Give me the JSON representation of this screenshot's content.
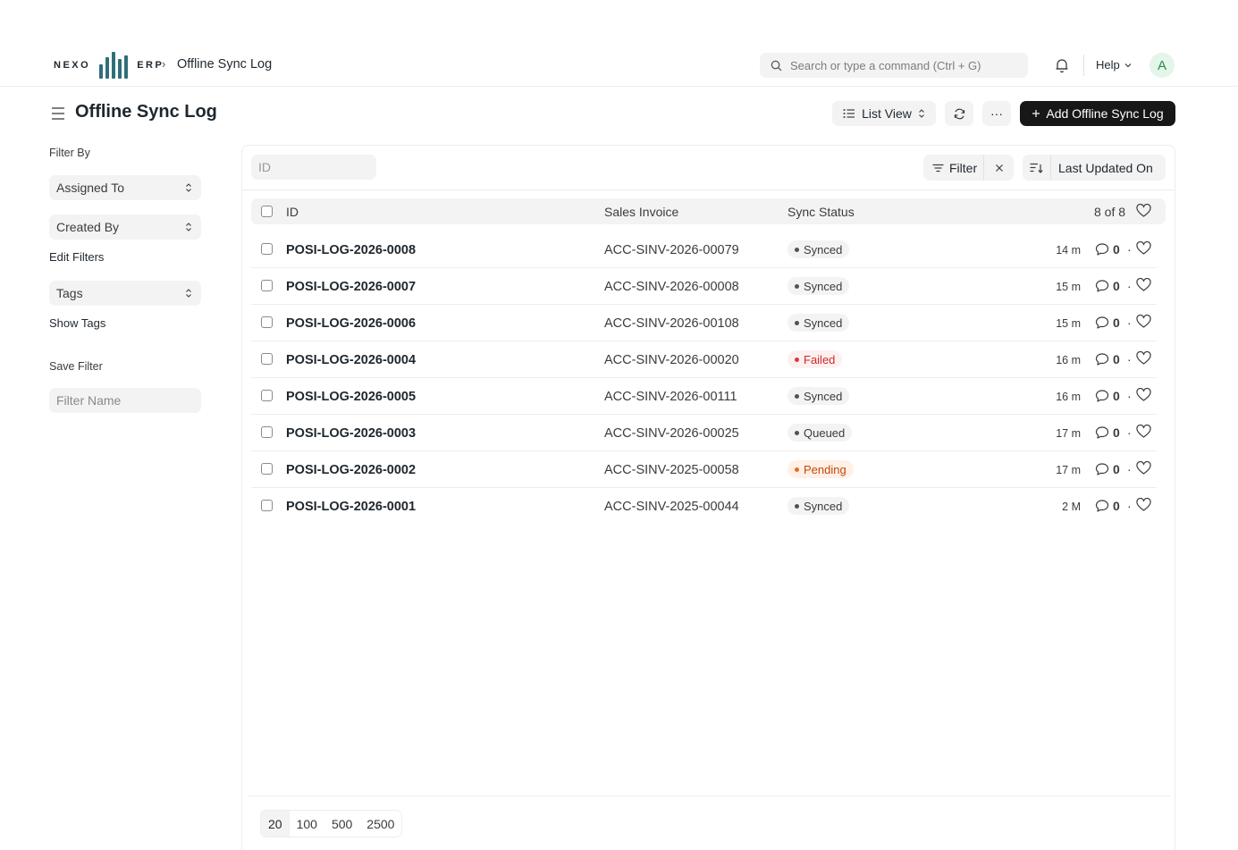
{
  "navbar": {
    "logo_left": "NEXO",
    "logo_right": "ERP",
    "breadcrumb_sep": "›",
    "breadcrumb": "Offline Sync Log",
    "search_placeholder": "Search or type a command (Ctrl + G)",
    "help_label": "Help",
    "avatar_initial": "A"
  },
  "page": {
    "title": "Offline Sync Log",
    "list_view_label": "List View",
    "more_label": "···",
    "add_label": "Add Offline Sync Log"
  },
  "sidebar": {
    "filter_by_label": "Filter By",
    "assigned_to_label": "Assigned To",
    "created_by_label": "Created By",
    "edit_filters_label": "Edit Filters",
    "tags_label": "Tags",
    "show_tags_label": "Show Tags",
    "save_filter_label": "Save Filter",
    "filter_name_placeholder": "Filter Name"
  },
  "toolbar": {
    "id_placeholder": "ID",
    "filter_label": "Filter",
    "sort_label": "Last Updated On"
  },
  "table": {
    "columns": {
      "id": "ID",
      "sales_invoice": "Sales Invoice",
      "sync_status": "Sync Status",
      "count": "8 of 8"
    },
    "rows": [
      {
        "id": "POSI-LOG-2026-0008",
        "invoice": "ACC-SINV-2026-00079",
        "status": "Synced",
        "time": "14 m",
        "comments": "0"
      },
      {
        "id": "POSI-LOG-2026-0007",
        "invoice": "ACC-SINV-2026-00008",
        "status": "Synced",
        "time": "15 m",
        "comments": "0"
      },
      {
        "id": "POSI-LOG-2026-0006",
        "invoice": "ACC-SINV-2026-00108",
        "status": "Synced",
        "time": "15 m",
        "comments": "0"
      },
      {
        "id": "POSI-LOG-2026-0004",
        "invoice": "ACC-SINV-2026-00020",
        "status": "Failed",
        "time": "16 m",
        "comments": "0"
      },
      {
        "id": "POSI-LOG-2026-0005",
        "invoice": "ACC-SINV-2026-00111",
        "status": "Synced",
        "time": "16 m",
        "comments": "0"
      },
      {
        "id": "POSI-LOG-2026-0003",
        "invoice": "ACC-SINV-2026-00025",
        "status": "Queued",
        "time": "17 m",
        "comments": "0"
      },
      {
        "id": "POSI-LOG-2026-0002",
        "invoice": "ACC-SINV-2025-00058",
        "status": "Pending",
        "time": "17 m",
        "comments": "0"
      },
      {
        "id": "POSI-LOG-2026-0001",
        "invoice": "ACC-SINV-2025-00044",
        "status": "Synced",
        "time": "2 M",
        "comments": "0"
      }
    ],
    "separator": "·"
  },
  "paging": {
    "options": [
      "20",
      "100",
      "500",
      "2500"
    ],
    "selected": "20"
  },
  "colors": {
    "accent": "#171717",
    "logo": "#2f6f78",
    "failed": "#cc2929",
    "pending": "#c4470a"
  }
}
